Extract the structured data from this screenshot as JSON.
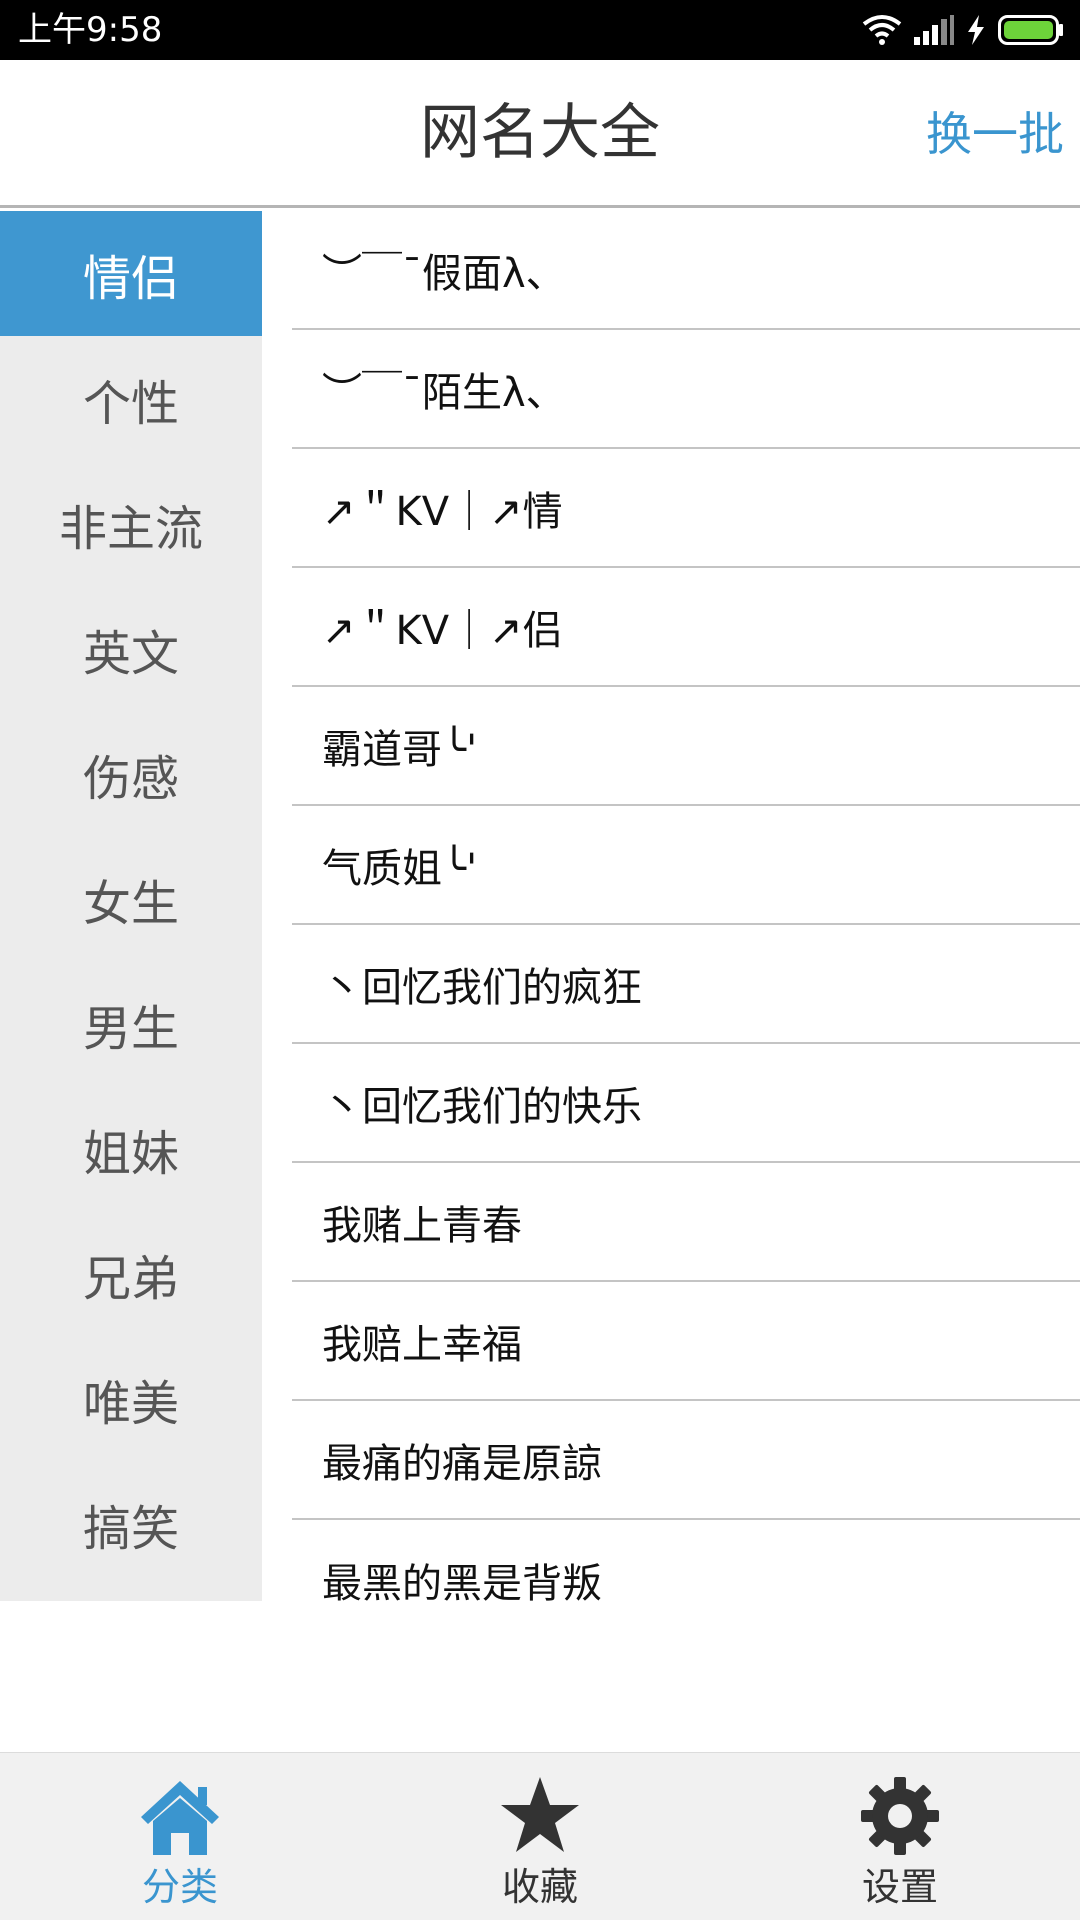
{
  "status_bar": {
    "time": "上午9:58",
    "battery_color": "#6dd33a"
  },
  "header": {
    "title": "网名大全",
    "refresh_label": "换一批",
    "accent_color": "#3a95cf"
  },
  "sidebar": {
    "items": [
      {
        "label": "情侣",
        "active": true
      },
      {
        "label": "个性"
      },
      {
        "label": "非主流"
      },
      {
        "label": "英文"
      },
      {
        "label": "伤感"
      },
      {
        "label": "女生"
      },
      {
        "label": "男生"
      },
      {
        "label": "姐妹"
      },
      {
        "label": "兄弟"
      },
      {
        "label": "唯美"
      },
      {
        "label": "搞笑"
      }
    ]
  },
  "names": [
    "︶￣ˉ假面λ、",
    "︶￣ˉ陌生λ、",
    "↗＂KV｜↗情",
    "↗＂KV｜↗侣",
    "霸道哥╰'",
    "气质姐╰'",
    "丶回忆我们的疯狂",
    "丶回忆我们的快乐",
    "我赌上青春",
    "我赔上幸福",
    "最痛的痛是原諒",
    "最黑的黑是背叛"
  ],
  "bottom_nav": {
    "items": [
      {
        "label": "分类",
        "icon": "home-icon",
        "active": true
      },
      {
        "label": "收藏",
        "icon": "star-icon"
      },
      {
        "label": "设置",
        "icon": "gear-icon"
      }
    ]
  }
}
